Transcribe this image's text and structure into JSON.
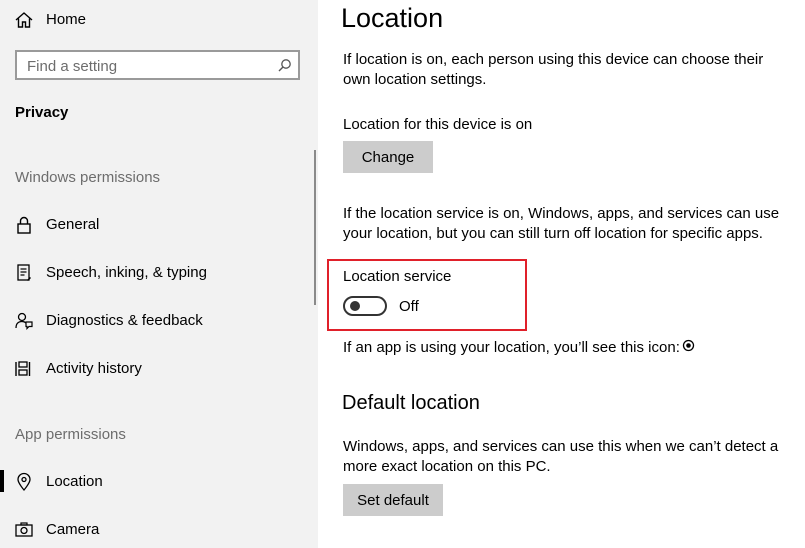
{
  "sidebar": {
    "home": "Home",
    "search_placeholder": "Find a setting",
    "section": "Privacy",
    "windows_permissions": "Windows permissions",
    "app_permissions": "App permissions",
    "items": [
      {
        "label": "General",
        "icon": "lock-icon"
      },
      {
        "label": "Speech, inking, & typing",
        "icon": "speech-icon"
      },
      {
        "label": "Diagnostics & feedback",
        "icon": "feedback-icon"
      },
      {
        "label": "Activity history",
        "icon": "activity-icon"
      },
      {
        "label": "Location",
        "icon": "location-icon",
        "selected": true
      },
      {
        "label": "Camera",
        "icon": "camera-icon"
      }
    ]
  },
  "main": {
    "title": "Location",
    "intro": "If location is on, each person using this device can choose their own location settings.",
    "device_status": "Location for this device is on",
    "change_button": "Change",
    "service_desc": "If the location service is on, Windows, apps, and services can use your location, but you can still turn off location for specific apps.",
    "service_label": "Location service",
    "service_state": "Off",
    "icon_note": "If an app is using your location, you’ll see this icon:",
    "default_heading": "Default location",
    "default_desc": "Windows, apps, and services can use this when we can’t detect a more exact location on this PC.",
    "set_default_button": "Set default"
  },
  "colors": {
    "sidebar_bg": "#f2f2f2",
    "button_bg": "#cccccc",
    "highlight": "#e0202a"
  }
}
